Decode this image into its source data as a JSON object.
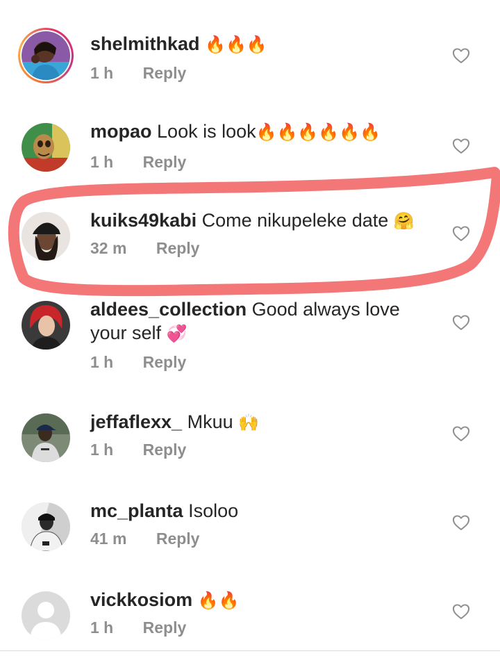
{
  "comments": [
    {
      "username": "shelmithkad",
      "text": "",
      "emoji": "🔥🔥🔥",
      "time": "1 h",
      "reply": "Reply",
      "avatar": "woman-portrait-avatar",
      "story_ring": true
    },
    {
      "username": "mopao",
      "text": "Look is look",
      "emoji": "🔥🔥🔥🔥🔥🔥",
      "time": "1 h",
      "reply": "Reply",
      "avatar": "cartoon-character-avatar",
      "story_ring": false
    },
    {
      "username": "kuiks49kabi",
      "text": "Come nikupeleke date",
      "emoji": "🤗",
      "time": "32 m",
      "reply": "Reply",
      "avatar": "person-in-hat-avatar",
      "story_ring": false
    },
    {
      "username": "aldees_collection",
      "text": "Good always love your self",
      "emoji": "💞",
      "time": "1 h",
      "reply": "Reply",
      "avatar": "woman-red-hair-avatar",
      "story_ring": false
    },
    {
      "username": "jeffaflexx_",
      "text": "Mkuu",
      "emoji": "🙌",
      "time": "1 h",
      "reply": "Reply",
      "avatar": "man-cap-avatar",
      "story_ring": false
    },
    {
      "username": "mc_planta",
      "text": "Isoloo",
      "emoji": "",
      "time": "41 m",
      "reply": "Reply",
      "avatar": "man-bw-photo-avatar",
      "story_ring": false
    },
    {
      "username": "vickkosiom",
      "text": "",
      "emoji": "🔥🔥",
      "time": "1 h",
      "reply": "Reply",
      "avatar": "default-user-avatar",
      "story_ring": false
    }
  ],
  "colors": {
    "username": "#262626",
    "meta": "#8e8e8e",
    "heart_outline": "#8e8e8e",
    "highlight_stroke": "#f26b6b",
    "story_ring": [
      "#f77737",
      "#fcaf45",
      "#e1306c",
      "#c13584"
    ]
  },
  "icons": {
    "like": "heart-outline-icon",
    "fire": "fire-emoji",
    "hug": "hugging-face-emoji",
    "hearts": "revolving-hearts-emoji",
    "hands": "raising-hands-emoji"
  }
}
